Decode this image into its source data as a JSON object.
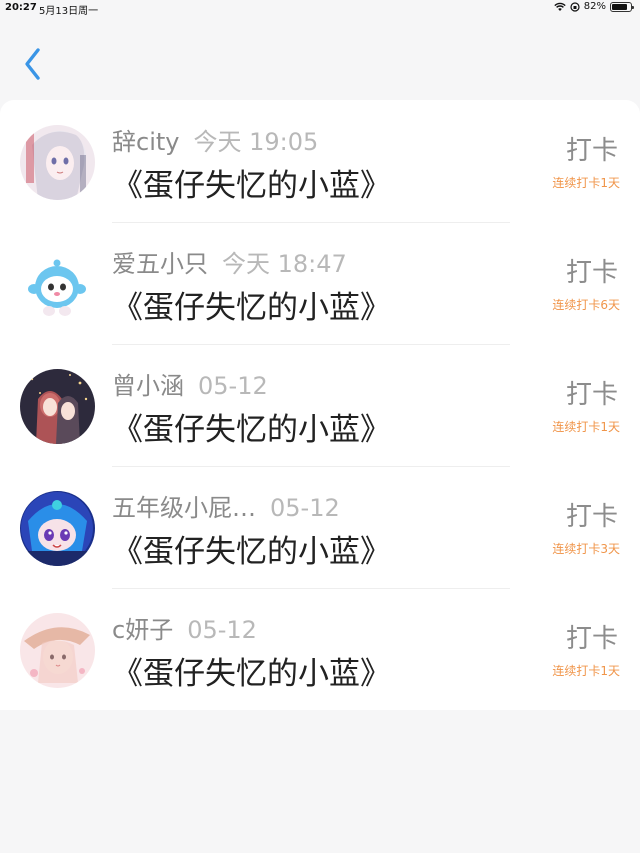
{
  "status_bar": {
    "time": "20:27",
    "date": "5月13日周一",
    "battery": "82%",
    "battery_level": 0.82
  },
  "header": {
    "back_icon": "chevron-left-icon",
    "accent": "#3a95e6"
  },
  "entries": [
    {
      "name": "辞city",
      "time": "今天 19:05",
      "book": "《蛋仔失忆的小蓝》",
      "action": "打卡",
      "streak": "连续打卡1天",
      "avatar": "anime-girl-white-hair"
    },
    {
      "name": "爱五小只",
      "time": "今天 18:47",
      "book": "《蛋仔失忆的小蓝》",
      "action": "打卡",
      "streak": "连续打卡6天",
      "avatar": "blue-egg-character"
    },
    {
      "name": "曾小涵",
      "time": "05-12",
      "book": "《蛋仔失忆的小蓝》",
      "action": "打卡",
      "streak": "连续打卡1天",
      "avatar": "night-sky-couple"
    },
    {
      "name": "五年级小屁…",
      "time": "05-12",
      "book": "《蛋仔失忆的小蓝》",
      "action": "打卡",
      "streak": "连续打卡3天",
      "avatar": "blue-hair-chibi"
    },
    {
      "name": "c妍子",
      "time": "05-12",
      "book": "《蛋仔失忆的小蓝》",
      "action": "打卡",
      "streak": "连续打卡1天",
      "avatar": "pink-hat-girl"
    }
  ]
}
